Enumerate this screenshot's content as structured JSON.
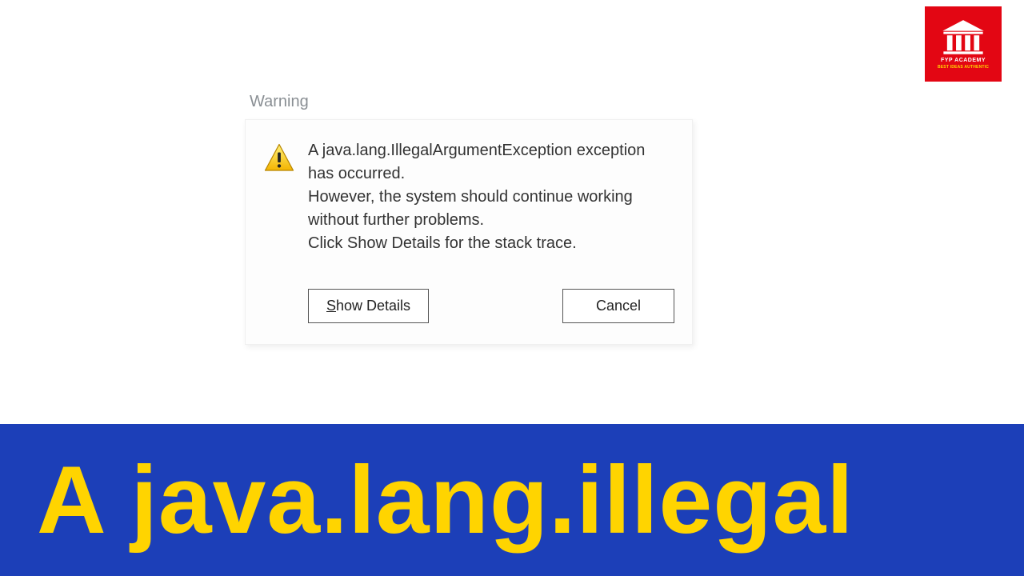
{
  "logo": {
    "title": "FYP ACADEMY",
    "subtitle": "BEST IDEAS AUTHENTIC",
    "bg_color": "#e30613",
    "icon_color": "#ffffff"
  },
  "dialog": {
    "title": "Warning",
    "icon": "warning-triangle",
    "message_line1": "A java.lang.IllegalArgumentException exception has occurred.",
    "message_line2": "However, the system should continue working without further problems.",
    "message_line3": "Click Show Details for the stack trace.",
    "buttons": {
      "show_details": "Show Details",
      "show_details_mnemonic_prefix": "S",
      "show_details_rest": "how Details",
      "cancel": "Cancel"
    }
  },
  "banner": {
    "text": "A java.lang.illegal",
    "bg_color": "#1c3fb8",
    "fg_color": "#ffd400"
  }
}
